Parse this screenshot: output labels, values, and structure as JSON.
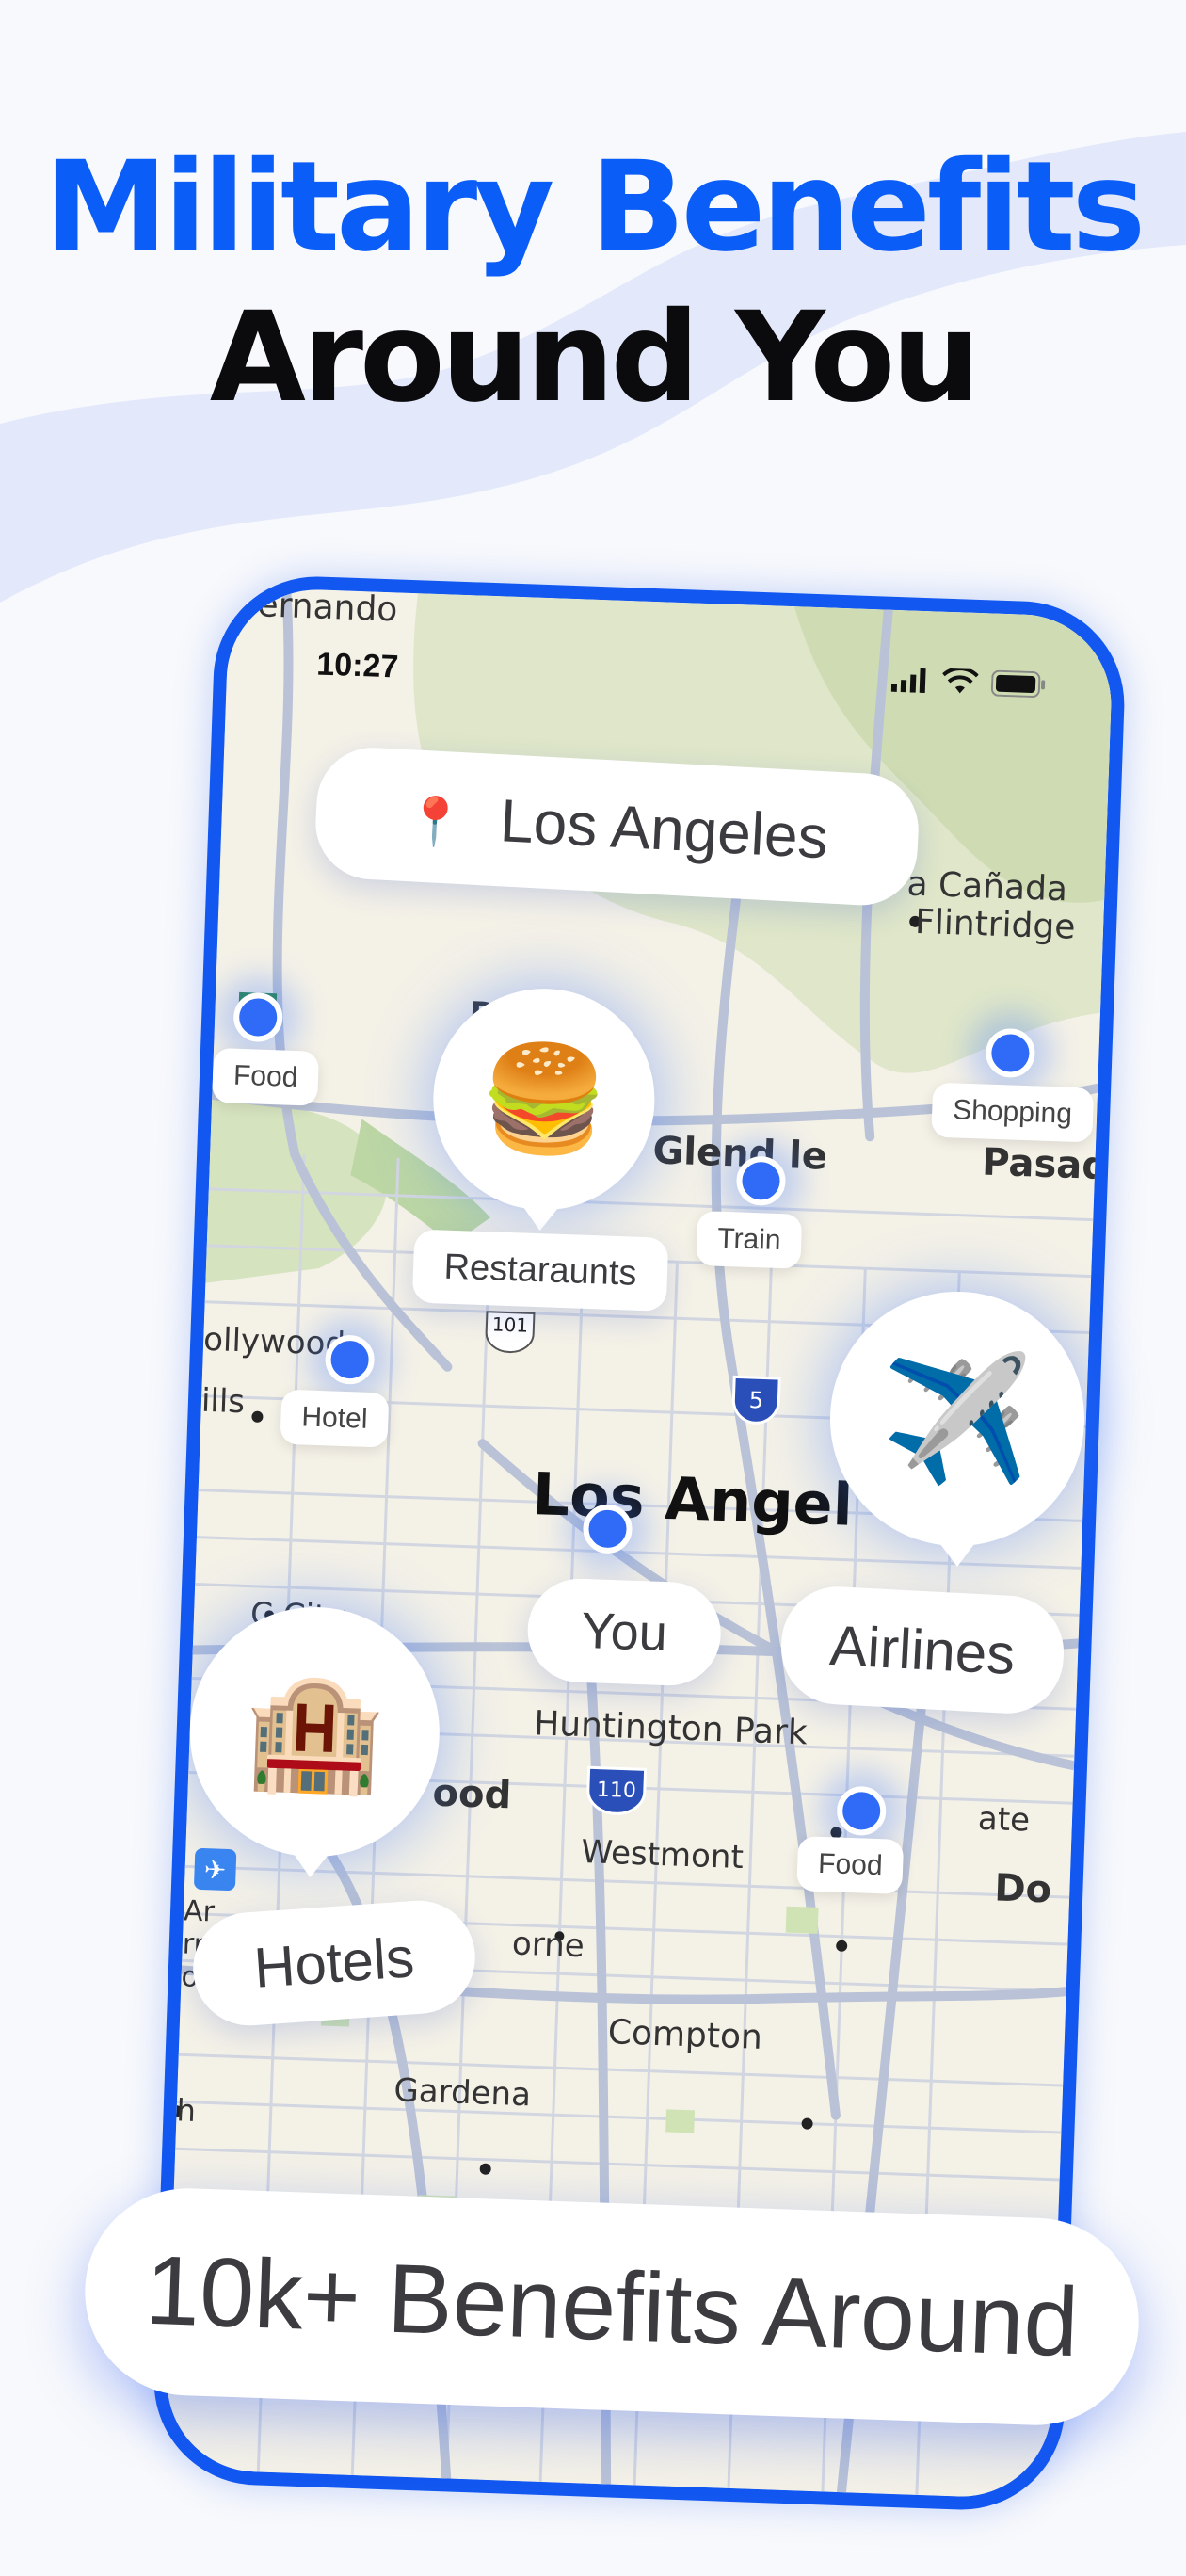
{
  "headline": {
    "line1": "Military Benefits",
    "line2": "Around You"
  },
  "status": {
    "time": "10:27"
  },
  "search": {
    "icon": "pin-icon",
    "label": "Los Angeles"
  },
  "map_labels": {
    "san_fernando": "ernando",
    "la_canada": "a Cañada",
    "flintridge": "Flintridge",
    "burbank": "B      k",
    "glendale": "Glend  le",
    "pasadena": "Pasad",
    "hollywood": "ollywood",
    "hills": "ills",
    "los_angeles": "Los Angel",
    "culver_city": "C      City",
    "huntington_park": "Huntington Park",
    "inglewood": "ood",
    "westmont": "Westmont",
    "hawthorne": "orne",
    "downey": "Do",
    "south_gate": "ate",
    "compton": "Compton",
    "gardena": "Gardena",
    "states": "ates",
    "airport_a": "Ar",
    "airport_b": "rn",
    "airport_c": "or",
    "beach": "h",
    "shield_170": "170",
    "shield_101": "101",
    "shield_5": "5",
    "shield_110": "110"
  },
  "markers": {
    "food_1": "Food",
    "shopping": "Shopping",
    "train": "Train",
    "hotel": "Hotel",
    "food_2": "Food",
    "you": "You"
  },
  "categories": {
    "restaurants": {
      "label": "Restaraunts",
      "emoji": "🍔"
    },
    "airlines": {
      "label": "Airlines",
      "emoji": "✈️"
    },
    "hotels": {
      "label": "Hotels",
      "emoji": "🏨"
    }
  },
  "banner": {
    "label": "10k+ Benefits Around"
  },
  "colors": {
    "accent": "#0a5ef7",
    "frame": "#1257f0",
    "dot": "#2f6bf6"
  }
}
